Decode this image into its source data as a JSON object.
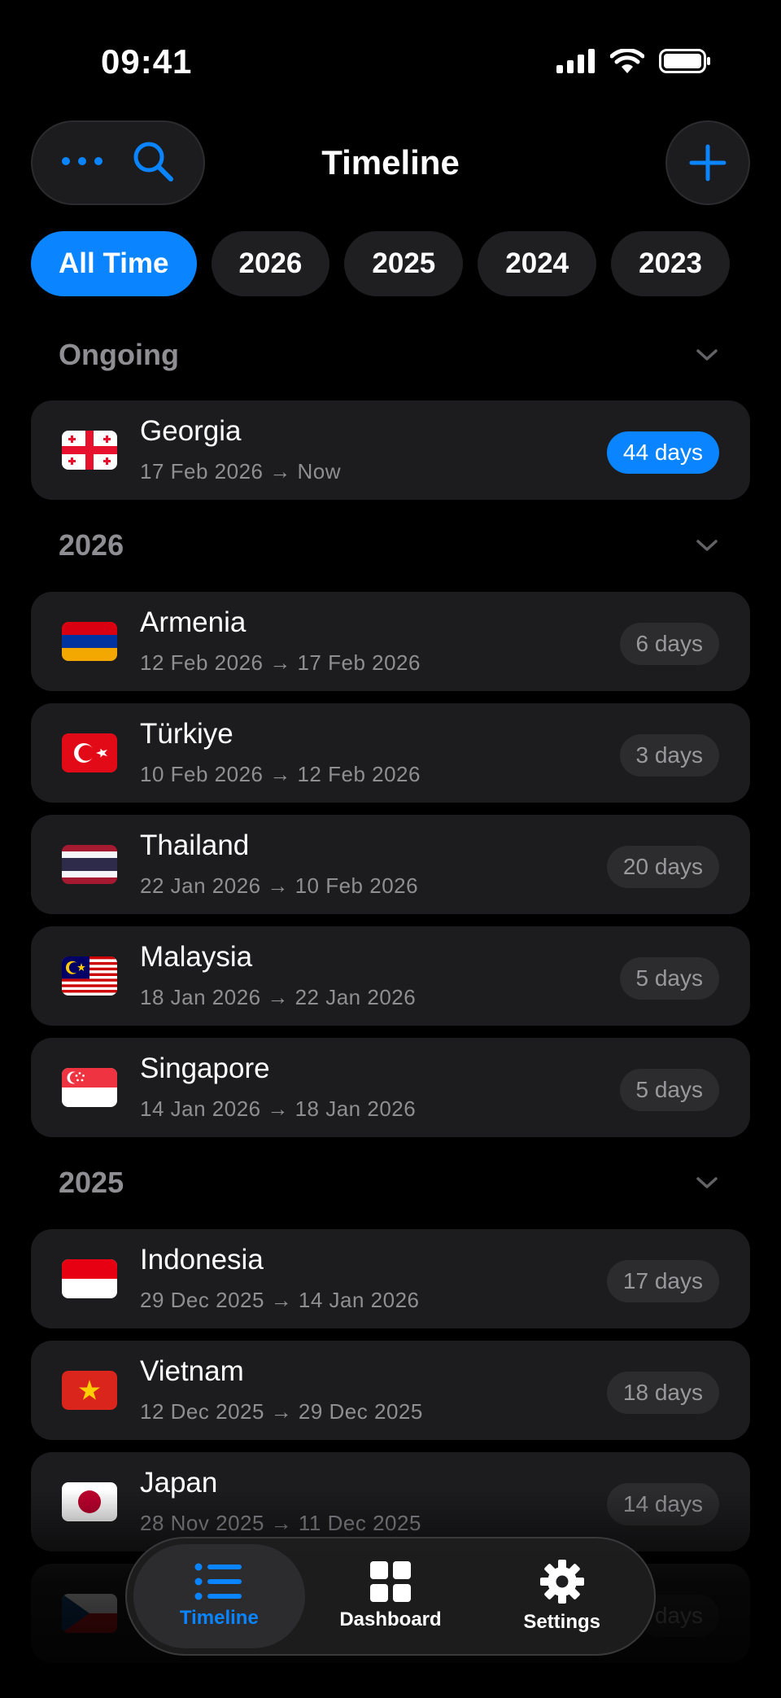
{
  "status_bar": {
    "time": "09:41"
  },
  "header": {
    "title": "Timeline"
  },
  "filters": [
    "All Time",
    "2026",
    "2025",
    "2024",
    "2023"
  ],
  "sections": [
    {
      "title": "Ongoing",
      "trips": [
        {
          "country": "Georgia",
          "dates": "17 Feb 2026 → Now",
          "duration": "44 days",
          "ongoing": true
        }
      ]
    },
    {
      "title": "2026",
      "trips": [
        {
          "country": "Armenia",
          "dates": "12 Feb 2026 → 17 Feb 2026",
          "duration": "6 days"
        },
        {
          "country": "Türkiye",
          "dates": "10 Feb 2026 → 12 Feb 2026",
          "duration": "3 days"
        },
        {
          "country": "Thailand",
          "dates": "22 Jan 2026 → 10 Feb 2026",
          "duration": "20 days"
        },
        {
          "country": "Malaysia",
          "dates": "18 Jan 2026 → 22 Jan 2026",
          "duration": "5 days"
        },
        {
          "country": "Singapore",
          "dates": "14 Jan 2026 → 18 Jan 2026",
          "duration": "5 days"
        }
      ]
    },
    {
      "title": "2025",
      "trips": [
        {
          "country": "Indonesia",
          "dates": "29 Dec 2025 → 14 Jan 2026",
          "duration": "17 days"
        },
        {
          "country": "Vietnam",
          "dates": "12 Dec 2025 → 29 Dec 2025",
          "duration": "18 days"
        },
        {
          "country": "Japan",
          "dates": "28 Nov 2025 → 11 Dec 2025",
          "duration": "14 days"
        },
        {
          "country": "",
          "dates": "",
          "duration": "days"
        }
      ]
    }
  ],
  "tabs": [
    {
      "label": "Timeline",
      "icon": "list-icon",
      "active": true
    },
    {
      "label": "Dashboard",
      "icon": "grid-icon"
    },
    {
      "label": "Settings",
      "icon": "gear-icon"
    }
  ],
  "colors": {
    "accent": "#0a84ff",
    "background": "#000000",
    "card": "#1c1c1e"
  }
}
